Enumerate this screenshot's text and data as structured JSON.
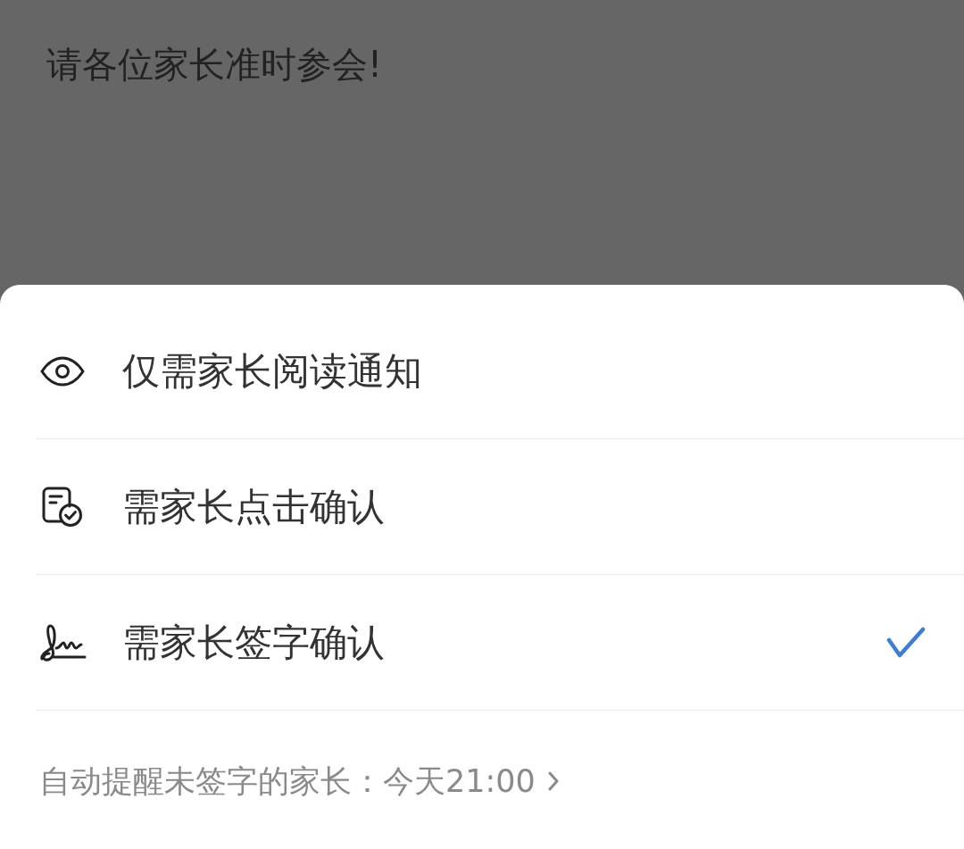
{
  "notice": {
    "text": "请各位家长准时参会!"
  },
  "options": [
    {
      "kind": "read",
      "label": "仅需家长阅读通知",
      "selected": false
    },
    {
      "kind": "confirm",
      "label": "需家长点击确认",
      "selected": false
    },
    {
      "kind": "sign",
      "label": "需家长签字确认",
      "selected": true
    }
  ],
  "reminder": {
    "text": "自动提醒未签字的家长：今天21:00"
  }
}
